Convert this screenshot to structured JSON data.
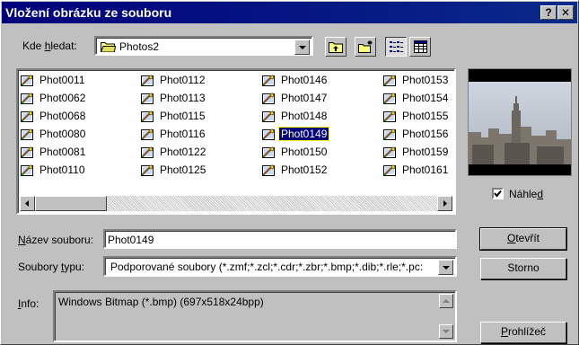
{
  "title": "Vložení obrázku ze souboru",
  "titlebar_buttons": {
    "help": "?",
    "close": "✕"
  },
  "look_in": {
    "label_pre": "Kde ",
    "label_ul": "h",
    "label_post": "ledat:",
    "value": "Photos2"
  },
  "files": [
    [
      "Phot0011",
      "Phot0062",
      "Phot0068",
      "Phot0080",
      "Phot0081",
      "Phot0110"
    ],
    [
      "Phot0112",
      "Phot0113",
      "Phot0115",
      "Phot0116",
      "Phot0122",
      "Phot0125"
    ],
    [
      "Phot0146",
      "Phot0147",
      "Phot0148",
      "Phot0149",
      "Phot0150",
      "Phot0152"
    ],
    [
      "Phot0153",
      "Phot0154",
      "Phot0155",
      "Phot0156",
      "Phot0159",
      "Phot0161"
    ]
  ],
  "selected_file": "Phot0149",
  "preview": {
    "label_pre": "Náhle",
    "label_ul": "d",
    "label_post": "",
    "checked": true
  },
  "filename": {
    "label_ul": "N",
    "label_post": "ázev souboru:",
    "value": "Phot0149"
  },
  "filetype": {
    "label_pre": "Soubory ",
    "label_ul": "t",
    "label_post": "ypu:",
    "value": "Podporované soubory (*.zmf;*.zcl;*.cdr;*.zbr;*.bmp;*.dib;*.rle;*.pc:"
  },
  "info": {
    "label_ul": "I",
    "label_post": "nfo:",
    "value": "Windows Bitmap (*.bmp) (697x518x24bpp)"
  },
  "buttons": {
    "open": {
      "ul": "O",
      "post": "tevřít"
    },
    "cancel": "Storno",
    "browser": {
      "ul": "P",
      "post": "rohlížeč"
    }
  },
  "icons": {
    "folder": "folder-icon",
    "up": "up-folder-icon",
    "new_folder": "new-folder-icon",
    "list": "list-view-icon",
    "details": "details-view-icon",
    "file": "image-file-icon"
  }
}
